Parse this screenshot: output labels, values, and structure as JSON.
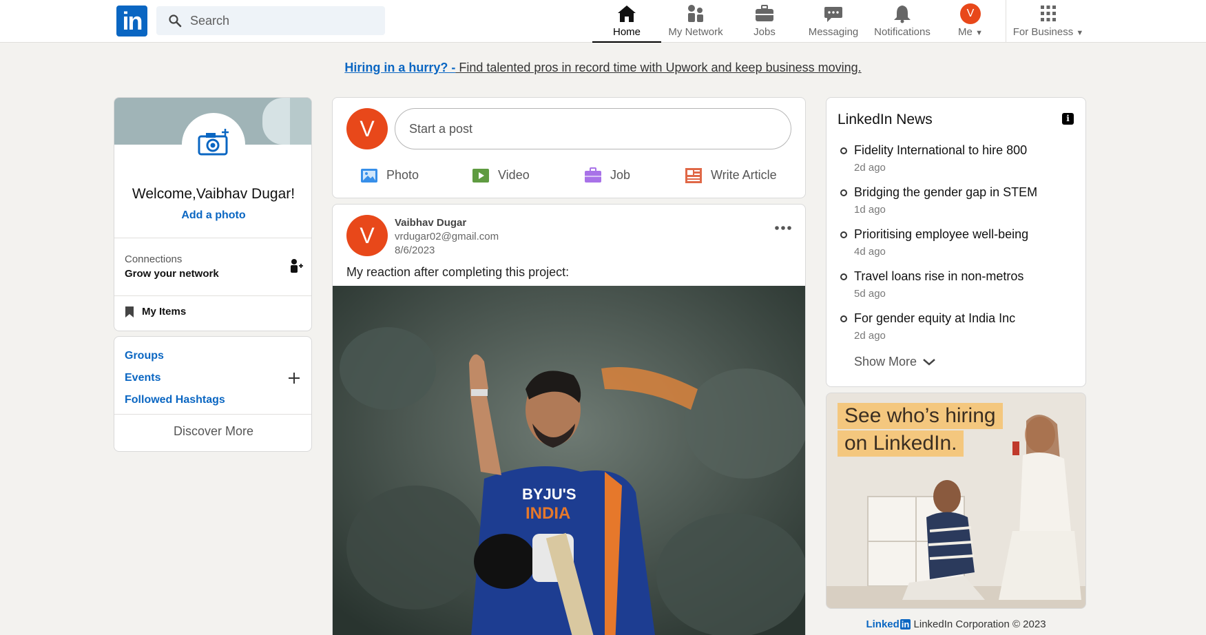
{
  "nav": {
    "logo_text": "in",
    "search_placeholder": "Search",
    "items": [
      {
        "label": "Home",
        "icon": "home-icon",
        "active": true
      },
      {
        "label": "My Network",
        "icon": "network-icon"
      },
      {
        "label": "Jobs",
        "icon": "briefcase-icon"
      },
      {
        "label": "Messaging",
        "icon": "message-icon"
      },
      {
        "label": "Notifications",
        "icon": "bell-icon"
      },
      {
        "label": "Me",
        "avatar_letter": "V"
      },
      {
        "label": "For Business",
        "icon": "grid-icon"
      }
    ]
  },
  "promo": {
    "strong": "Hiring in a hurry? -",
    "rest": " Find talented pros in record time with Upwork and keep business moving."
  },
  "profile": {
    "welcome": "Welcome,Vaibhav Dugar!",
    "add_photo": "Add a photo",
    "connections_label": "Connections",
    "connections_sub": "Grow your network",
    "my_items": "My Items"
  },
  "groups": {
    "links": [
      "Groups",
      "Events",
      "Followed Hashtags"
    ],
    "discover": "Discover More"
  },
  "share": {
    "avatar_letter": "V",
    "placeholder": "Start a post",
    "actions": [
      "Photo",
      "Video",
      "Job",
      "Write Article"
    ]
  },
  "post": {
    "avatar_letter": "V",
    "author": "Vaibhav Dugar",
    "email": "vrdugar02@gmail.com",
    "date": "8/6/2023",
    "text": "My reaction after completing this project:",
    "image_jersey_text_1": "BYJU'S",
    "image_jersey_text_2": "INDIA"
  },
  "news": {
    "title": "LinkedIn News",
    "info_glyph": "i",
    "items": [
      {
        "headline": "Fidelity International to hire 800",
        "ago": "2d ago"
      },
      {
        "headline": "Bridging the gender gap in STEM",
        "ago": "1d ago"
      },
      {
        "headline": "Prioritising employee well-being",
        "ago": "4d ago"
      },
      {
        "headline": "Travel loans rise in non-metros",
        "ago": "5d ago"
      },
      {
        "headline": "For gender equity at India Inc",
        "ago": "2d ago"
      }
    ],
    "show_more": "Show More"
  },
  "ad": {
    "line1": "See who’s hiring",
    "line2": "on LinkedIn."
  },
  "footer": {
    "logo_word": "Linked",
    "logo_box": "in",
    "text": "LinkedIn Corporation © 2023"
  },
  "colors": {
    "brand": "#0a66c2",
    "avatar": "#e8481a",
    "background": "#f3f2ef"
  }
}
